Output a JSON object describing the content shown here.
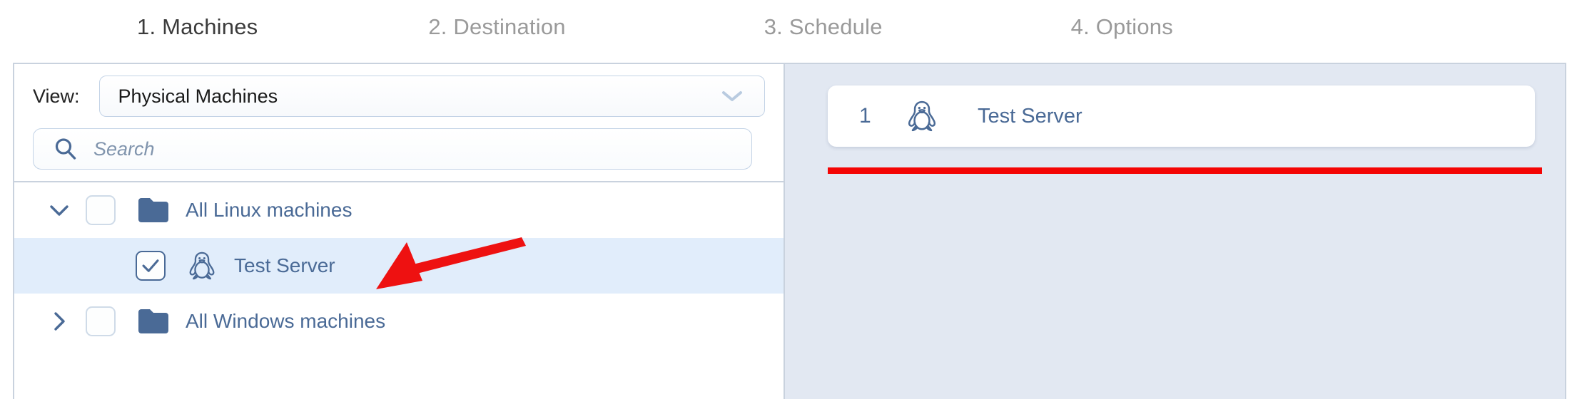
{
  "wizard": {
    "steps": [
      {
        "label": "1. Machines",
        "active": true
      },
      {
        "label": "2. Destination",
        "active": false
      },
      {
        "label": "3. Schedule",
        "active": false
      },
      {
        "label": "4. Options",
        "active": false
      }
    ]
  },
  "filters": {
    "view_label": "View:",
    "view_value": "Physical Machines",
    "view_chevron_icon": "chevron-down-icon",
    "search_placeholder": "Search",
    "search_value": "",
    "search_icon": "search-icon"
  },
  "tree": {
    "rows": [
      {
        "label": "All Linux machines",
        "twisty": "chevron-down-icon",
        "expanded": true,
        "checked": false,
        "icon": "folder-icon",
        "selected": false,
        "level": 0
      },
      {
        "label": "Test Server",
        "twisty": "",
        "expanded": false,
        "checked": true,
        "icon": "penguin-icon",
        "selected": true,
        "level": 1
      },
      {
        "label": "All Windows machines",
        "twisty": "chevron-right-icon",
        "expanded": false,
        "checked": false,
        "icon": "folder-icon",
        "selected": false,
        "level": 0
      }
    ]
  },
  "selection": {
    "items": [
      {
        "index": "1",
        "name": "Test Server",
        "icon": "penguin-icon"
      }
    ]
  },
  "annotations": {
    "arrow_color": "#ee1111",
    "underline_color": "#f40505"
  },
  "colors": {
    "accent_blue": "#4a6a96",
    "folder_blue": "#4a6a96",
    "selected_row": "#e1edfb",
    "right_panel_bg": "#e2e8f2",
    "border": "#c9d2de",
    "active_step": "#3b3b3b",
    "inactive_step": "#9a9a9a"
  }
}
